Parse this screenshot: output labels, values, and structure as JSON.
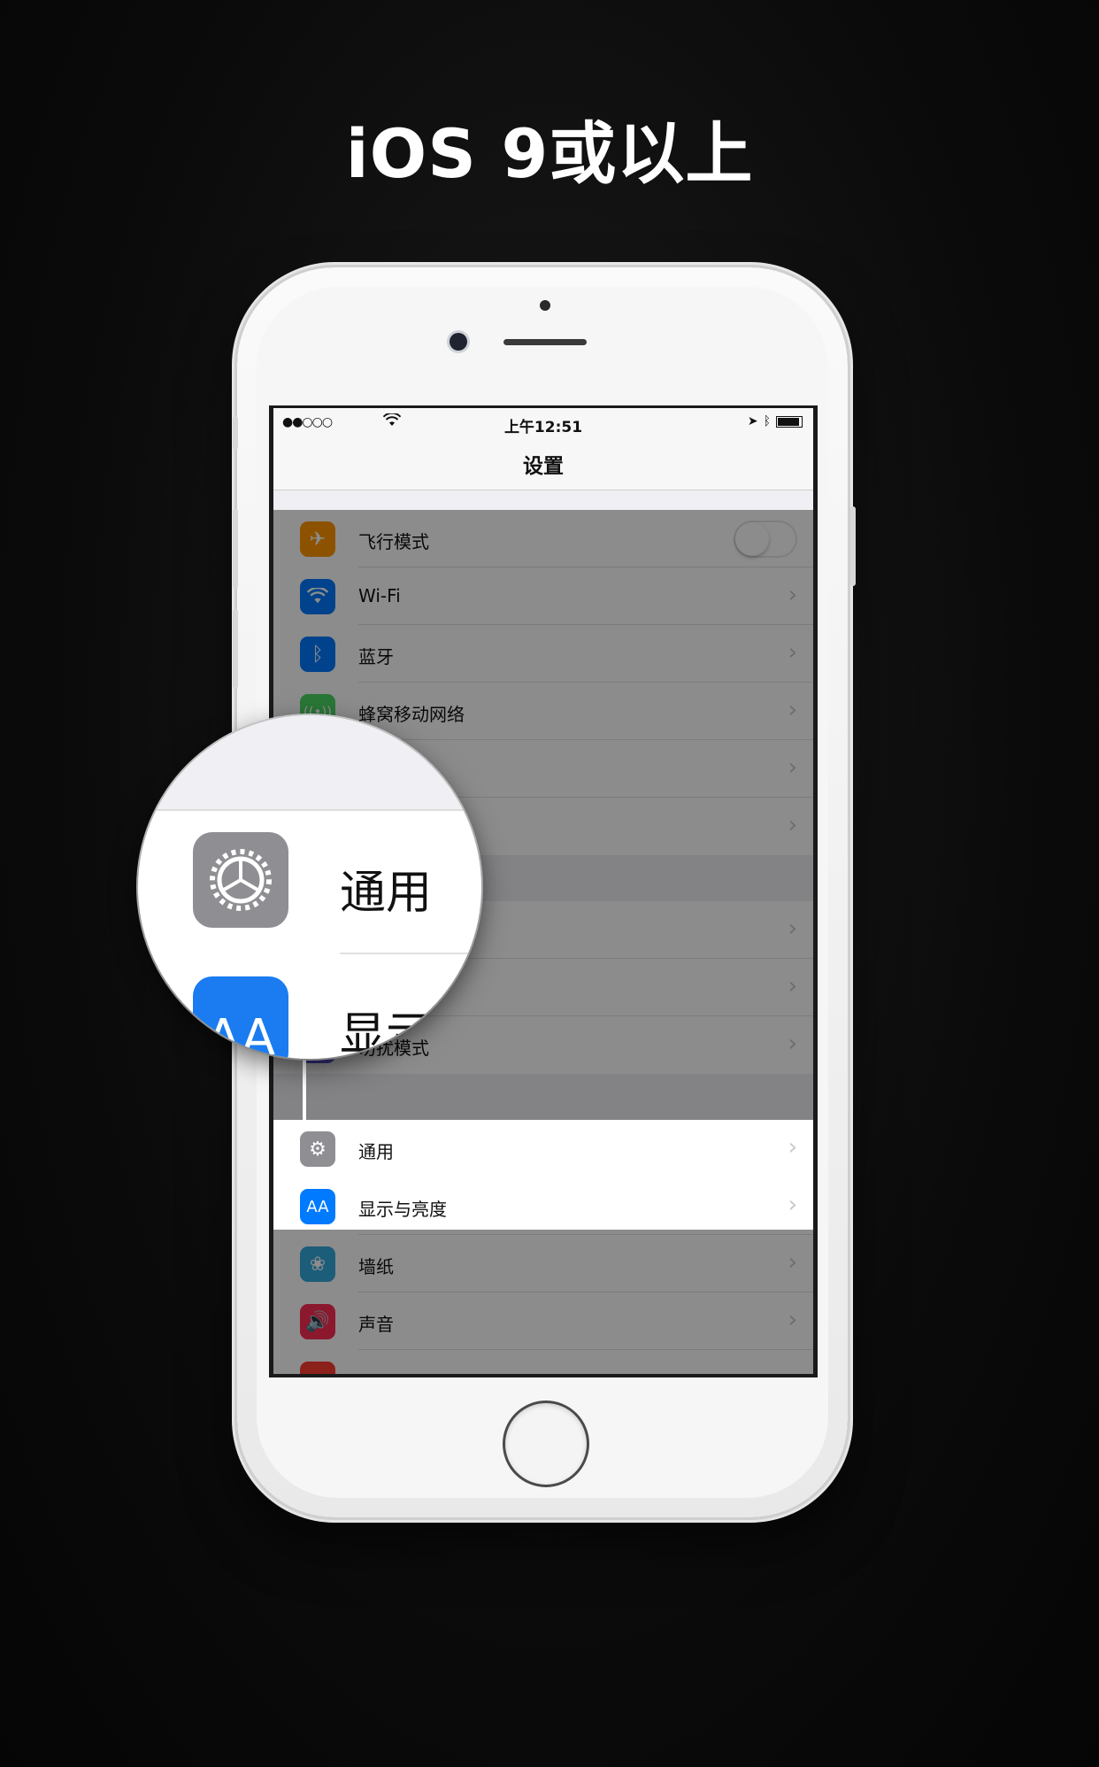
{
  "headline": "iOS 9或以上",
  "status_bar": {
    "signal": "●●○○○",
    "wifi": "wifi-icon",
    "time": "上午12:51",
    "location": "location-icon",
    "bluetooth": "bluetooth-icon",
    "battery": "battery-icon"
  },
  "nav": {
    "title": "设置"
  },
  "rows": [
    {
      "label": "飞行模式",
      "icon": "airplane-icon",
      "color": "#ff9500",
      "control": "toggle",
      "toggle_on": false
    },
    {
      "label": "Wi-Fi",
      "icon": "wifi-icon",
      "color": "#007aff",
      "control": "chevron"
    },
    {
      "label": "蓝牙",
      "icon": "bluetooth-icon",
      "color": "#007aff",
      "control": "chevron"
    },
    {
      "label": "蜂窝移动网络",
      "icon": "cellular-icon",
      "color": "#4cd964",
      "control": "chevron"
    },
    {
      "label": "",
      "control": "chevron"
    },
    {
      "label": "",
      "control": "chevron"
    },
    {
      "label": "",
      "control": "chevron"
    },
    {
      "label": "",
      "control": "chevron"
    },
    {
      "label": "勿扰模式",
      "icon": "moon-icon",
      "color": "#5856d6",
      "control": "chevron"
    },
    {
      "label": "通用",
      "icon": "gear-icon",
      "color": "#8e8e93",
      "control": "chevron",
      "highlighted": true
    },
    {
      "label": "显示与亮度",
      "icon": "text-size-icon",
      "color": "#007aff",
      "control": "chevron"
    },
    {
      "label": "墙纸",
      "icon": "wallpaper-icon",
      "color": "#34aadc",
      "control": "chevron"
    },
    {
      "label": "声音",
      "icon": "speaker-icon",
      "color": "#ff2d55",
      "control": "chevron"
    }
  ],
  "magnifier": {
    "label_primary": "通用",
    "icon_primary": "gear-icon",
    "label_secondary": "显示",
    "icon_secondary_text": "AA"
  },
  "colors": {
    "background": "#0b0b0b",
    "highlight": "#ffffff"
  }
}
